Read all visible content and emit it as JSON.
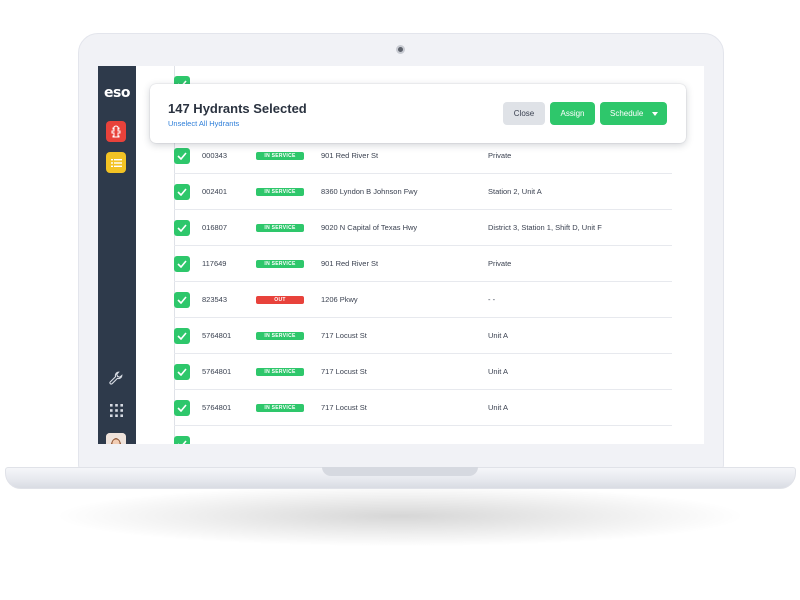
{
  "colors": {
    "sidebar": "#2e3a4b",
    "accent_green": "#2ec76b",
    "status_out_red": "#e8423b",
    "nav_red": "#e8423b",
    "nav_yellow": "#f3c324",
    "link_blue": "#2f7fd9",
    "close_button_bg": "#dfe2e7"
  },
  "sidebar": {
    "logo": "eso",
    "items": [
      {
        "name": "hydrant",
        "icon": "hydrant-icon",
        "color": "#e8423b"
      },
      {
        "name": "list",
        "icon": "list-icon",
        "color": "#f3c324"
      }
    ],
    "bottom_icons": [
      "wrench-icon",
      "apps-grid-icon"
    ],
    "avatar": "user-avatar"
  },
  "selection_bar": {
    "title": "147 Hydrants Selected",
    "unselect_link": "Unselect All Hydrants",
    "close_label": "Close",
    "assign_label": "Assign",
    "schedule_label": "Schedule"
  },
  "table": {
    "rows": [
      {
        "id": "000343",
        "status": "IN SERVICE",
        "address": "901 Red River St",
        "assignment": "Private"
      },
      {
        "id": "002401",
        "status": "IN SERVICE",
        "address": "8360 Lyndon B Johnson Fwy",
        "assignment": "Station 2, Unit A"
      },
      {
        "id": "016807",
        "status": "IN SERVICE",
        "address": "9020 N Capital of Texas Hwy",
        "assignment": "District 3, Station 1, Shift D, Unit F"
      },
      {
        "id": "117649",
        "status": "IN SERVICE",
        "address": "901 Red River St",
        "assignment": "Private"
      },
      {
        "id": "823543",
        "status": "OUT",
        "address": "1206 Pkwy",
        "assignment": "- -"
      },
      {
        "id": "5764801",
        "status": "IN SERVICE",
        "address": "717 Locust St",
        "assignment": "Unit A"
      },
      {
        "id": "5764801",
        "status": "IN SERVICE",
        "address": "717 Locust St",
        "assignment": "Unit A"
      },
      {
        "id": "5764801",
        "status": "IN SERVICE",
        "address": "717 Locust St",
        "assignment": "Unit A"
      }
    ]
  }
}
